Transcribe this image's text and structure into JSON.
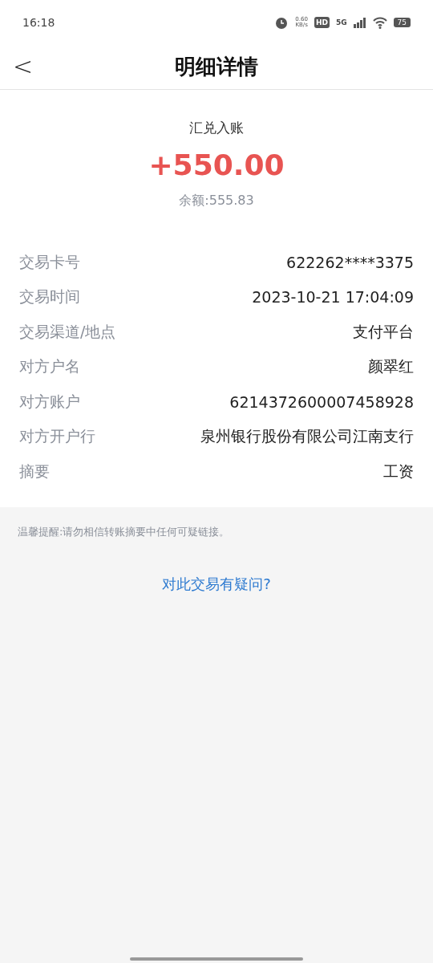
{
  "status_bar": {
    "time": "16:18",
    "net_speed": "0.60",
    "net_unit": "KB/s",
    "hd": "HD",
    "network": "5G",
    "battery": "75"
  },
  "header": {
    "back": "<",
    "title": "明细详情"
  },
  "summary": {
    "type": "汇兑入账",
    "amount": "+550.00",
    "balance": "余额:555.83"
  },
  "details": [
    {
      "label": "交易卡号",
      "value": "622262****3375"
    },
    {
      "label": "交易时间",
      "value": "2023-10-21 17:04:09"
    },
    {
      "label": "交易渠道/地点",
      "value": "支付平台"
    },
    {
      "label": "对方户名",
      "value": "颜翠红"
    },
    {
      "label": "对方账户",
      "value": "6214372600007458928"
    },
    {
      "label": "对方开户行",
      "value": "泉州银行股份有限公司江南支行"
    },
    {
      "label": "摘要",
      "value": "工资"
    }
  ],
  "notice": "温馨提醒:请勿相信转账摘要中任何可疑链接。",
  "link": "对此交易有疑问?"
}
